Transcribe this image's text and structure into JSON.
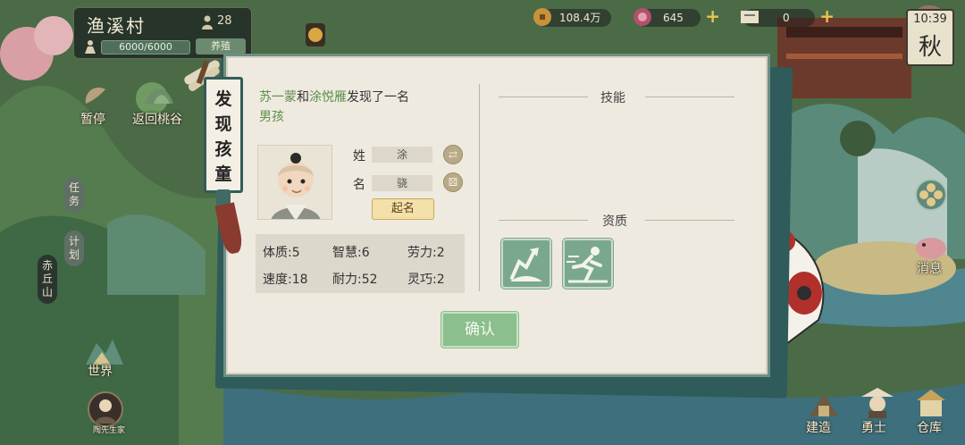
{
  "village": {
    "name": "渔溪村",
    "population": "28",
    "hp": "6000/6000",
    "action_label": "养殖"
  },
  "resources": {
    "coins": "108.4万",
    "gems": "645",
    "tickets": "0"
  },
  "clock": {
    "time": "10:39",
    "season": "秋"
  },
  "left_menu": {
    "pause": "暂停",
    "return": "返回桃谷",
    "task": "任务",
    "plan": "计划",
    "mountain": "赤丘山",
    "world": "世界",
    "avatar_caption": "陶先生家"
  },
  "right_menu": {
    "message": "消息",
    "build": "建造",
    "warrior": "勇士",
    "warehouse": "仓库"
  },
  "dialog": {
    "title_chars": [
      "发",
      "现",
      "孩",
      "童"
    ],
    "finder_1": "苏一蒙",
    "and": "和",
    "finder_2": "涂悦雁",
    "found_text": "发现了一名",
    "child_type": "男孩",
    "surname_label": "姓",
    "surname_value": "涂",
    "given_label": "名",
    "given_value": "骁",
    "name_button": "起名",
    "stats": [
      {
        "label": "体质:",
        "value": "5"
      },
      {
        "label": "智慧:",
        "value": "6"
      },
      {
        "label": "劳力:",
        "value": "2"
      },
      {
        "label": "速度:",
        "value": "18"
      },
      {
        "label": "耐力:",
        "value": "52"
      },
      {
        "label": "灵巧:",
        "value": "2"
      }
    ],
    "skills_title": "技能",
    "aptitude_title": "资质",
    "aptitude_icons": [
      "dig-aptitude-icon",
      "sprint-aptitude-icon"
    ],
    "confirm": "确认"
  },
  "colors": {
    "accent_green": "#5e8e4c",
    "confirm_bg": "#8bbf8e",
    "aptitude_bg": "#7aa88f",
    "scroll_border": "#325c5a"
  }
}
